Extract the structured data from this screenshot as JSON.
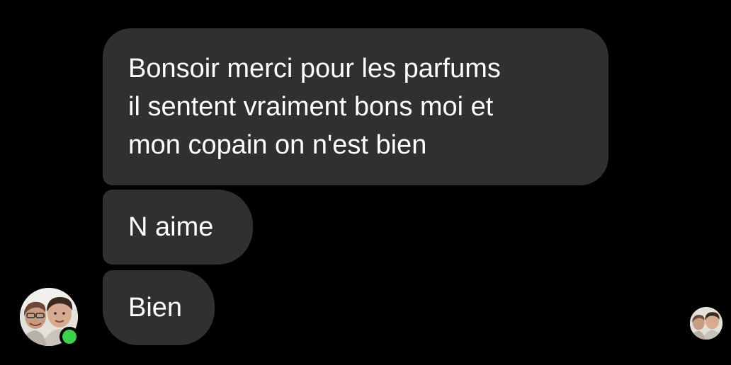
{
  "messages": [
    {
      "text": "Bonsoir merci pour les parfums\nil sentent vraiment bons moi et\nmon copain on n'est bien"
    },
    {
      "text": "N aime"
    },
    {
      "text": "Bien"
    }
  ],
  "contact": {
    "avatar_icon": "contact-avatar-photo",
    "online_status_color": "#3ecf4c"
  },
  "seen_receipt": {
    "avatar_icon": "seen-avatar-photo"
  },
  "colors": {
    "background": "#000000",
    "bubble": "#303030",
    "text": "#ffffff"
  }
}
